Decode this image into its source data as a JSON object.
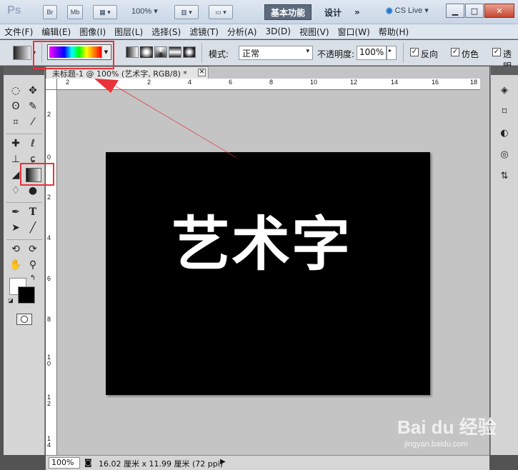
{
  "app": {
    "logo": "Ps",
    "bridge_label": "Br",
    "minibridge_label": "Mb",
    "zoom_label": "100%",
    "workspace_active": "基本功能",
    "workspace_design": "设计",
    "more_label": "»",
    "cs_live": "CS Live"
  },
  "menu": {
    "items": [
      {
        "label": "文件(F)"
      },
      {
        "label": "编辑(E)"
      },
      {
        "label": "图像(I)"
      },
      {
        "label": "图层(L)"
      },
      {
        "label": "选择(S)"
      },
      {
        "label": "滤镜(T)"
      },
      {
        "label": "分析(A)"
      },
      {
        "label": "3D(D)"
      },
      {
        "label": "视图(V)"
      },
      {
        "label": "窗口(W)"
      },
      {
        "label": "帮助(H)"
      }
    ]
  },
  "options": {
    "mode_label": "模式:",
    "mode_value": "正常",
    "opacity_label": "不透明度:",
    "opacity_value": "100%",
    "reverse_label": "反向",
    "dither_label": "仿色",
    "transparency_label": "透明"
  },
  "document": {
    "tab_title": "未标题-1 @ 100% (艺术字, RGB/8) *",
    "canvas_text": "艺术字",
    "hruler_ticks": [
      "2",
      "0",
      "2",
      "4",
      "6",
      "8",
      "10",
      "12",
      "14",
      "16",
      "18"
    ],
    "vruler_ticks": [
      "2",
      "0",
      "2",
      "4",
      "6",
      "8",
      "10",
      "12",
      "14"
    ]
  },
  "status": {
    "zoom": "100%",
    "doc_info": "16.02 厘米 x 11.99 厘米 (72 ppi)"
  },
  "watermark": {
    "logo": "Bai du 经验",
    "url": "jingyan.baidu.com"
  },
  "colors": {
    "annotation": "#e8333a",
    "foreground": "#ffffff",
    "background": "#000000"
  }
}
